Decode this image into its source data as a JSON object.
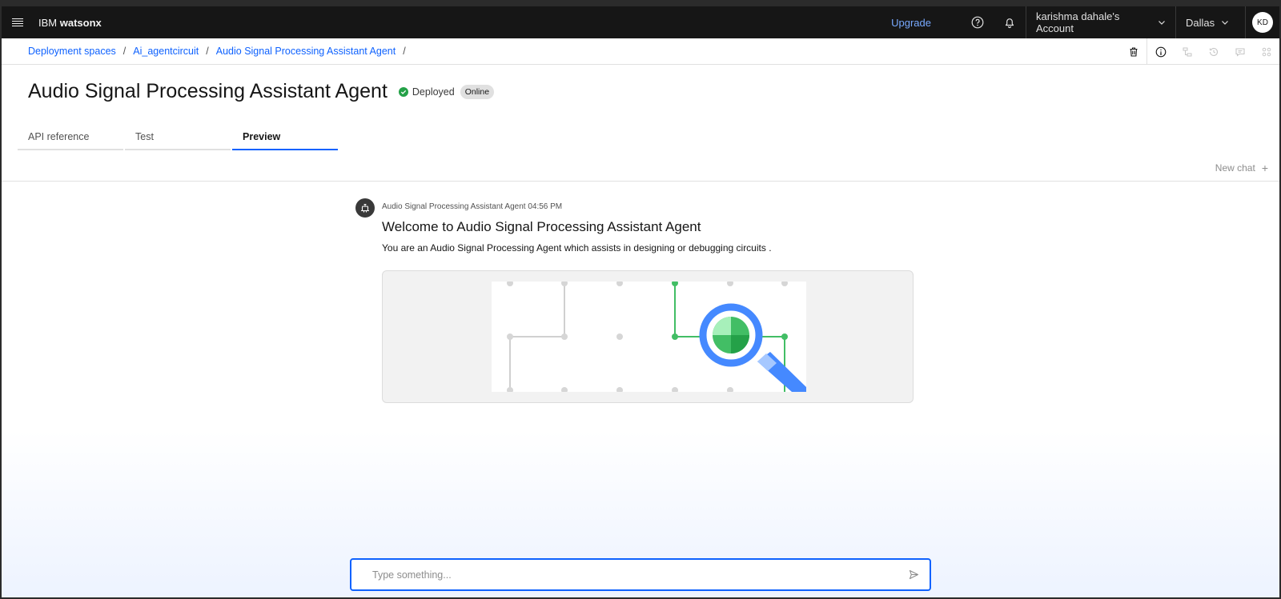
{
  "header": {
    "brand_prefix": "IBM",
    "brand_name": "watsonx",
    "upgrade": "Upgrade",
    "account": "karishma dahale's Account",
    "region": "Dallas",
    "avatar_initials": "KD"
  },
  "breadcrumb": {
    "items": [
      "Deployment spaces",
      "Ai_agentcircuit",
      "Audio Signal Processing Assistant Agent"
    ],
    "separator": "/"
  },
  "page": {
    "title": "Audio Signal Processing Assistant Agent",
    "status": "Deployed",
    "status_tag": "Online"
  },
  "tabs": [
    {
      "label": "API reference",
      "active": false
    },
    {
      "label": "Test",
      "active": false
    },
    {
      "label": "Preview",
      "active": true
    }
  ],
  "new_chat": "New chat",
  "message": {
    "meta": "Audio Signal Processing Assistant Agent 04:56 PM",
    "title": "Welcome to Audio Signal Processing Assistant Agent",
    "text": "You are an Audio Signal Processing Agent which assists in designing or debugging circuits ."
  },
  "composer": {
    "placeholder": "Type something..."
  },
  "colors": {
    "accent": "#0f62fe",
    "header_bg": "#161616",
    "success": "#24a148",
    "illustration_green": "#42be65",
    "illustration_blue": "#4589ff"
  },
  "icons": [
    "menu-icon",
    "help-icon",
    "notification-icon",
    "chevron-down-icon",
    "trash-icon",
    "info-icon",
    "flow-icon",
    "history-icon",
    "comment-icon",
    "apps-icon",
    "check-circle-icon",
    "robot-icon",
    "send-icon",
    "plus-icon"
  ]
}
